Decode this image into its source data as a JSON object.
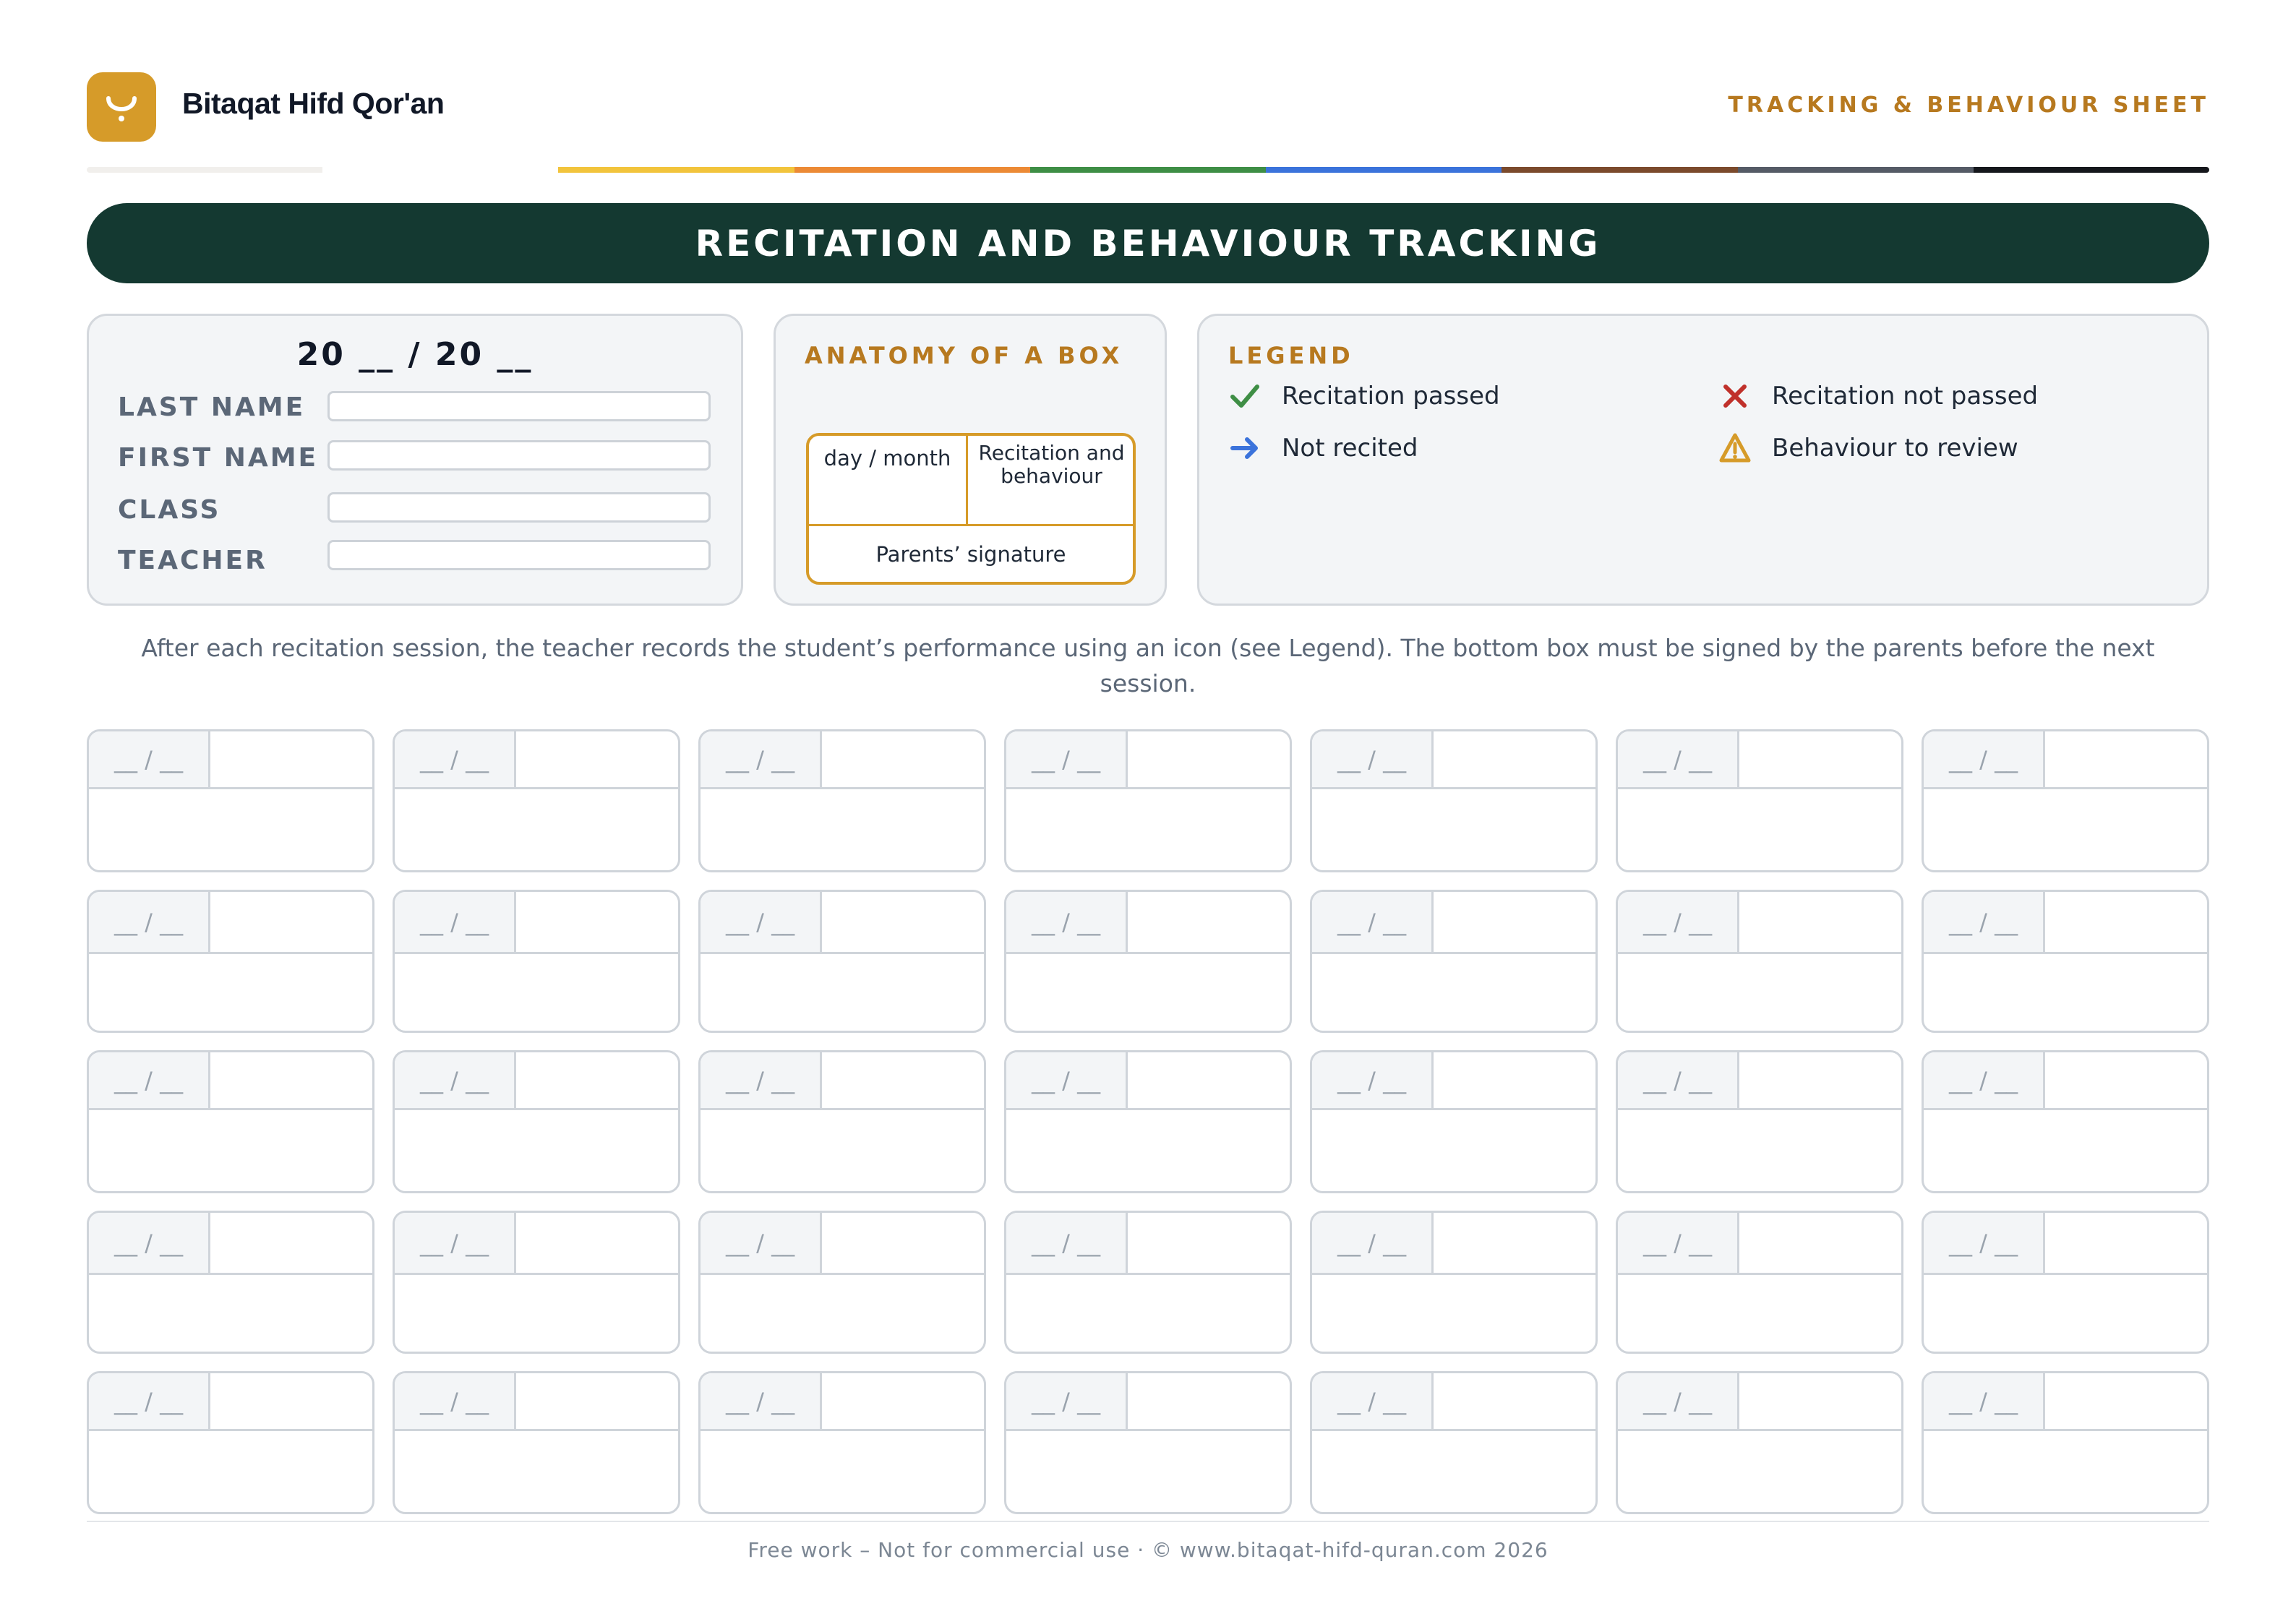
{
  "header": {
    "logo_icon": "arabic-letter-icon",
    "brand": "Bitaqat Hifd Qor'an",
    "sheet_label": "TRACKING & BEHAVIOUR SHEET",
    "strip_colors": [
      "#f1efec",
      "#ffffff",
      "#f2c43c",
      "#ec8a35",
      "#3e8e45",
      "#3b73db",
      "#7b4a2c",
      "#555b66",
      "#15171c"
    ]
  },
  "banner": {
    "title": "RECITATION AND BEHAVIOUR TRACKING"
  },
  "student": {
    "year": "20 __ / 20 __",
    "fields": [
      {
        "label": "LAST NAME",
        "value": ""
      },
      {
        "label": "FIRST NAME",
        "value": ""
      },
      {
        "label": "CLASS",
        "value": ""
      },
      {
        "label": "TEACHER",
        "value": ""
      }
    ]
  },
  "anatomy": {
    "title": "ANATOMY OF A BOX",
    "date_cell": "day / month",
    "mark_cell": "Recitation and behaviour",
    "signature_cell": "Parents’ signature"
  },
  "legend": {
    "title": "LEGEND",
    "items": [
      {
        "icon": "check-icon",
        "label": "Recitation passed",
        "color": "#3e8e45"
      },
      {
        "icon": "cross-icon",
        "label": "Recitation not passed",
        "color": "#c0312b"
      },
      {
        "icon": "arrow-right-icon",
        "label": "Not recited",
        "color": "#3b73db"
      },
      {
        "icon": "warning-icon",
        "label": "Behaviour to review",
        "color": "#d69b29"
      }
    ]
  },
  "instructions": "After each recitation session, the teacher records the student’s performance using an icon (see Legend). The bottom box must be signed by the parents before the next session.",
  "sessions": {
    "date_placeholder": "__ / __"
  },
  "footer": {
    "text": "Free work – Not for commercial use · © www.bitaqat-hifd-quran.com 2026"
  },
  "colors": {
    "accent": "#d69b29",
    "banner": "#143931",
    "label_gold": "#b7791f"
  }
}
